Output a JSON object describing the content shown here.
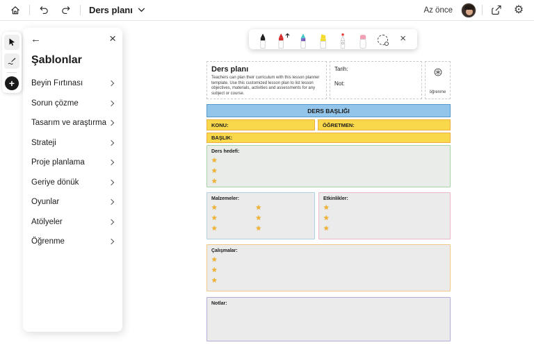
{
  "topbar": {
    "board_title": "Ders planı",
    "status": "Az önce",
    "icons": [
      "home-icon",
      "undo-icon",
      "redo-icon",
      "chevron-down-icon",
      "avatar",
      "share-icon",
      "settings-gear-icon"
    ]
  },
  "tool_rail": {
    "tools": [
      "select-cursor",
      "ink-pen",
      "add-plus"
    ]
  },
  "templates_panel": {
    "title": "Şablonlar",
    "items": [
      "Beyin Fırtınası",
      "Sorun çözme",
      "Tasarım ve araştırma",
      "Strateji",
      "Proje planlama",
      "Geriye dönük",
      "Oyunlar",
      "Atölyeler",
      "Öğrenme"
    ],
    "back_icon": "←",
    "close_icon": "×"
  },
  "pen_toolbar": {
    "tools": [
      "black-marker",
      "red-marker",
      "galaxy-marker",
      "yellow-highlighter",
      "bling-pen",
      "eraser",
      "lasso-select",
      "close"
    ],
    "close_icon": "×"
  },
  "lesson_plan": {
    "star_icon": "★",
    "header": {
      "title": "Ders planı",
      "description": "Teachers can plan their curriculum with this lesson planner template. Use this customized lesson plan to list lesson objectives, materials, activities and assessments for any subject or course.",
      "date_label": "Tarih:",
      "note_label": "Not:",
      "badge_label": "öğrenme"
    },
    "banner": "DERS BAŞLIĞI",
    "subject_label": "KONU:",
    "teacher_label": "ÖĞRETMEN:",
    "title_label": "BAŞLIK:",
    "objective": {
      "label": "Ders hedefi:",
      "stars": 3
    },
    "materials": {
      "label": "Malzemeler:",
      "stars_col1": 3,
      "stars_col2": 3
    },
    "activities": {
      "label": "Etkinlikler:",
      "stars": 3
    },
    "practices": {
      "label": "Çalışmalar:",
      "stars": 3
    },
    "notes": {
      "label": "Notlar:"
    }
  },
  "colors": {
    "banner_fill": "#92C5E9",
    "banner_border": "#5598CC",
    "yellow_fill": "#F9D84B",
    "yellow_border": "#EBAE3F",
    "section_fill": "#EBEBEB",
    "objective_fill": "#E9ECE8",
    "objective_border": "#A3D5A3",
    "materials_border": "#AFCFE3",
    "activities_border": "#ECB6CF",
    "practices_border": "#F0C883",
    "notes_border": "#B3ABD6",
    "star": "#F2B233"
  }
}
